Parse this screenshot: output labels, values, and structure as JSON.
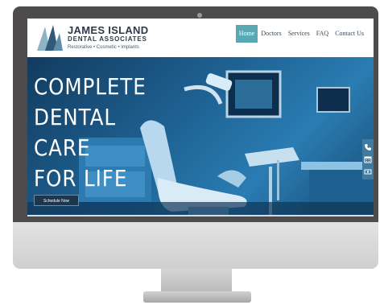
{
  "header": {
    "logo_title": "JAMES ISLAND",
    "logo_subtitle": "DENTAL ASSOCIATES",
    "logo_tagline": "Restorative • Cosmetic • Implants"
  },
  "nav": {
    "items": [
      {
        "label": "Home",
        "active": true
      },
      {
        "label": "Doctors"
      },
      {
        "label": "Services"
      },
      {
        "label": "FAQ"
      },
      {
        "label": "Contact Us"
      }
    ]
  },
  "hero": {
    "title": "COMPLETE DENTAL CARE FOR LIFE",
    "cta_label": "Schedule Now"
  },
  "sidebar_icons": [
    "phone-icon",
    "calendar-icon",
    "money-icon"
  ],
  "colors": {
    "nav_active": "#5aa8b4",
    "hero_overlay": "#1f6496",
    "brand_text": "#2d3a4a"
  }
}
